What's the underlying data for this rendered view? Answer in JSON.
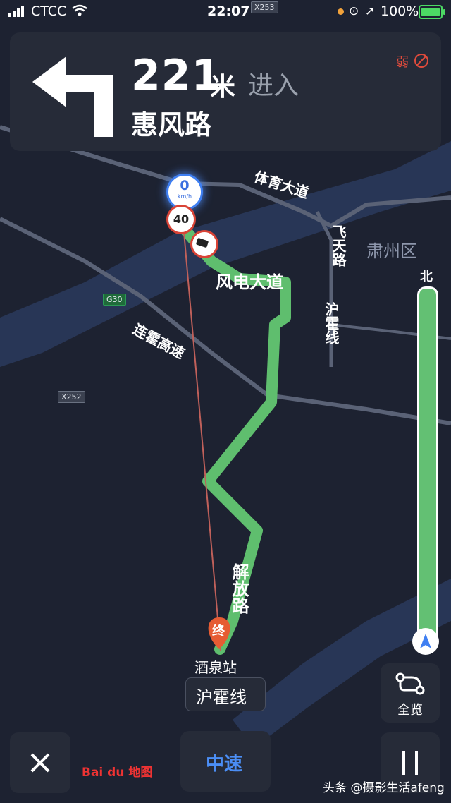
{
  "status_bar": {
    "carrier": "CTCC",
    "time": "22:07",
    "battery": "100%"
  },
  "nav": {
    "distance": "221",
    "unit": "米",
    "action": "进入",
    "road": "惠风路",
    "signal": "弱"
  },
  "map": {
    "speed": "0",
    "speed_unit": "km/h",
    "speed_limit": "40",
    "roads": {
      "tiyu": "体育大道",
      "fengdian": "风电大道",
      "feitian": "飞天路",
      "huhuo_v": "沪霍线",
      "lianhuo": "连霍高速",
      "jiefang": "解放路",
      "bei": "北"
    },
    "district": "肃州区",
    "shields": {
      "x253": "X253",
      "g30": "G30",
      "x252": "X252"
    },
    "destination_marker": "终",
    "station": "酒泉站",
    "station_line": "沪霍线"
  },
  "controls": {
    "overview": "全览",
    "speed_mode": "中速",
    "close_icon": "close-icon",
    "pause_icon": "pause-icon"
  },
  "branding": {
    "logo": "Bai du 地图",
    "watermark": "头条 @摄影生活afeng"
  },
  "colors": {
    "route": "#5fbe6e",
    "background": "#1d2231",
    "accent": "#3f7ff2"
  }
}
